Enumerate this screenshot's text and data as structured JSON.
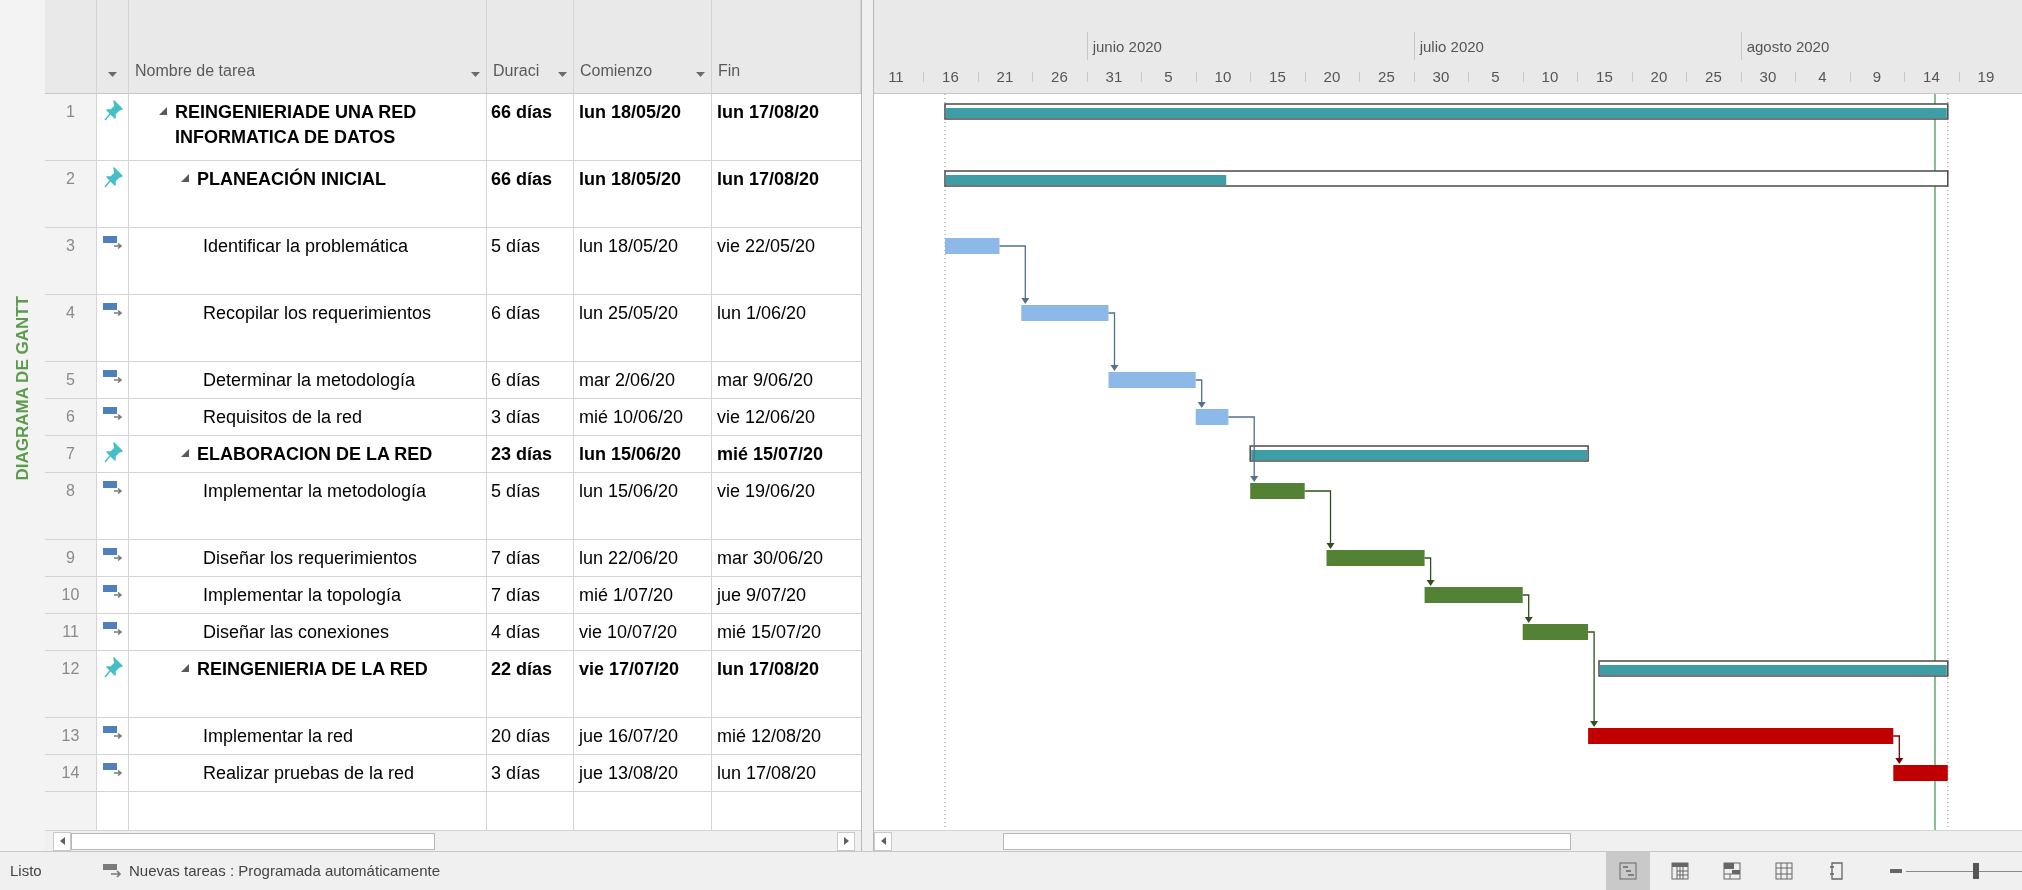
{
  "side_label": "DIAGRAMA DE GANTT",
  "columns": [
    {
      "kind": "mode",
      "filter": true
    },
    {
      "kind": "name",
      "label": "Nombre de tarea",
      "filter": true
    },
    {
      "kind": "duration",
      "label": "Duraci",
      "filter": true
    },
    {
      "kind": "start",
      "label": "Comienzo",
      "filter": true
    },
    {
      "kind": "finish",
      "label": "Fin",
      "filter": false
    }
  ],
  "tasks": [
    {
      "id": "1",
      "kind": "summary",
      "expanded": true,
      "name": "REINGENIERIADE UNA RED INFORMATICA DE DATOS",
      "duration": "66 días",
      "start": "lun 18/05/20",
      "finish": "lun 17/08/20",
      "level": 1,
      "children": [
        {
          "id": "2",
          "kind": "summary",
          "expanded": true,
          "name": "PLANEACIÓN INICIAL",
          "duration": "66 días",
          "start": "lun 18/05/20",
          "finish": "lun 17/08/20",
          "level": 0.28,
          "children": [
            {
              "id": "3",
              "kind": "task",
              "name": "Identificar la problemática",
              "duration": "5 días",
              "start": "lun 18/05/20",
              "finish": "vie 22/05/20",
              "color": "#8db9e9"
            },
            {
              "id": "4",
              "kind": "task",
              "name": "Recopilar los requerimientos",
              "duration": "6 días",
              "start": "lun 25/05/20",
              "finish": "lun 1/06/20",
              "color": "#8db9e9"
            },
            {
              "id": "5",
              "kind": "task",
              "name": "Determinar la metodología",
              "duration": "6 días",
              "start": "mar 2/06/20",
              "finish": "mar 9/06/20",
              "color": "#8db9e9"
            },
            {
              "id": "6",
              "kind": "task",
              "name": "Requisitos de la red",
              "duration": "3 días",
              "start": "mié 10/06/20",
              "finish": "vie 12/06/20",
              "color": "#8db9e9"
            }
          ]
        },
        {
          "id": "7",
          "kind": "summary",
          "expanded": true,
          "name": "ELABORACION DE LA RED",
          "duration": "23 días",
          "start": "lun 15/06/20",
          "finish": "mié 15/07/20",
          "level": 1,
          "children": [
            {
              "id": "8",
              "kind": "task",
              "name": "Implementar la metodología",
              "duration": "5 días",
              "start": "lun 15/06/20",
              "finish": "vie 19/06/20",
              "color": "#548235"
            },
            {
              "id": "9",
              "kind": "task",
              "name": "Diseñar los requerimientos",
              "duration": "7 días",
              "start": "lun 22/06/20",
              "finish": "mar 30/06/20",
              "color": "#548235"
            },
            {
              "id": "10",
              "kind": "task",
              "name": "Implementar la topología",
              "duration": "7 días",
              "start": "mié 1/07/20",
              "finish": "jue 9/07/20",
              "color": "#548235"
            },
            {
              "id": "11",
              "kind": "task",
              "name": "Diseñar las conexiones",
              "duration": "4 días",
              "start": "vie 10/07/20",
              "finish": "mié 15/07/20",
              "color": "#548235"
            }
          ]
        },
        {
          "id": "12",
          "kind": "summary",
          "expanded": true,
          "name": "REINGENIERIA DE LA RED",
          "duration": "22 días",
          "start": "vie 17/07/20",
          "finish": "lun 17/08/20",
          "level": 1,
          "children": [
            {
              "id": "13",
              "kind": "task",
              "name": "Implementar la red",
              "duration": "20 días",
              "start": "jue 16/07/20",
              "finish": "mié 12/08/20",
              "color": "#c00000"
            },
            {
              "id": "14",
              "kind": "task",
              "name": "Realizar pruebas de la red",
              "duration": "3 días",
              "start": "jue 13/08/20",
              "finish": "lun 17/08/20",
              "color": "#c00000"
            }
          ]
        }
      ]
    }
  ],
  "timescale": {
    "months": [
      "junio 2020",
      "julio 2020",
      "agosto 2020"
    ],
    "days": [
      "11",
      "16",
      "21",
      "26",
      "31",
      "5",
      "10",
      "15",
      "20",
      "25",
      "30",
      "5",
      "10",
      "15",
      "20",
      "25",
      "30",
      "4",
      "9",
      "14",
      "19"
    ]
  },
  "status_bar": {
    "state": "Listo",
    "new_tasks": "Nuevas tareas : Programada automáticamente",
    "views": [
      {
        "kind": "gantt",
        "selected": true
      },
      {
        "kind": "task-usage",
        "selected": false
      },
      {
        "kind": "team-planner",
        "selected": false
      },
      {
        "kind": "resource-sheet",
        "selected": false
      },
      {
        "kind": "report",
        "selected": false
      }
    ],
    "zoom": {
      "level": 0.6
    }
  }
}
